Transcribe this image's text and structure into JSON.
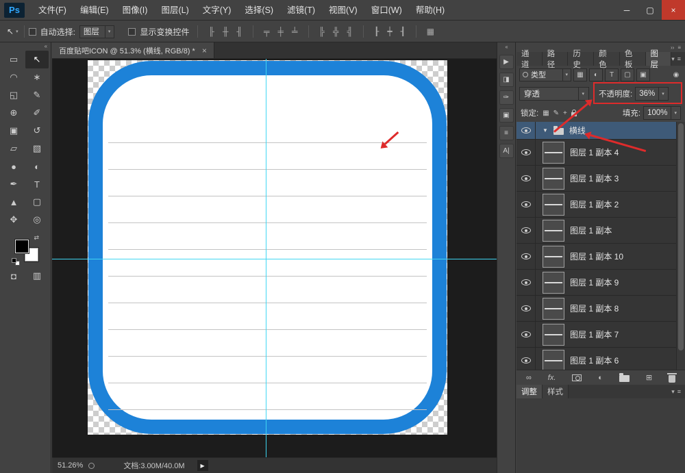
{
  "window": {
    "logo": "Ps",
    "minimize_glyph": "─",
    "maximize_glyph": "▢",
    "close_glyph": "×"
  },
  "menu": {
    "items": [
      "文件(F)",
      "编辑(E)",
      "图像(I)",
      "图层(L)",
      "文字(Y)",
      "选择(S)",
      "滤镜(T)",
      "视图(V)",
      "窗口(W)",
      "帮助(H)"
    ]
  },
  "options": {
    "tool_glyph": "↖",
    "auto_select_label": "自动选择:",
    "auto_select_value": "图层",
    "show_transform_label": "显示变换控件",
    "align_icons": [
      "╟",
      "╫",
      "╢",
      "╤",
      "╪",
      "╧",
      "╠",
      "╬",
      "╣",
      "┠",
      "┿",
      "┨"
    ],
    "distribute_icon": "▦"
  },
  "document": {
    "tab_title": "百度贴吧ICON @ 51.3% (横线, RGB/8) *",
    "close_glyph": "×"
  },
  "toolbar": {
    "collapse_glyph": "‹‹",
    "tools": [
      {
        "name": "rectangular-marquee-tool",
        "glyph": "▭"
      },
      {
        "name": "move-tool",
        "glyph": "↖",
        "selected": true
      },
      {
        "name": "lasso-tool",
        "glyph": "◠"
      },
      {
        "name": "magic-wand-tool",
        "glyph": "∗"
      },
      {
        "name": "crop-tool",
        "glyph": "◱"
      },
      {
        "name": "eyedropper-tool",
        "glyph": "✎"
      },
      {
        "name": "healing-brush-tool",
        "glyph": "⊕"
      },
      {
        "name": "brush-tool",
        "glyph": "✐"
      },
      {
        "name": "clone-stamp-tool",
        "glyph": "▣"
      },
      {
        "name": "history-brush-tool",
        "glyph": "↺"
      },
      {
        "name": "eraser-tool",
        "glyph": "▱"
      },
      {
        "name": "gradient-tool",
        "glyph": "▧"
      },
      {
        "name": "blur-tool",
        "glyph": "●"
      },
      {
        "name": "dodge-tool",
        "glyph": "◐"
      },
      {
        "name": "pen-tool",
        "glyph": "✒"
      },
      {
        "name": "type-tool",
        "glyph": "T"
      },
      {
        "name": "path-selection-tool",
        "glyph": "▲"
      },
      {
        "name": "rectangle-tool",
        "glyph": "▢"
      },
      {
        "name": "hand-tool",
        "glyph": "✥"
      },
      {
        "name": "zoom-tool",
        "glyph": "◎"
      },
      {
        "name": "quick-mask-tool",
        "glyph": "◘"
      },
      {
        "name": "screen-mode-tool",
        "glyph": "▥"
      }
    ]
  },
  "vstrip": {
    "collapse_glyph": "‹‹",
    "icons": [
      {
        "name": "actions-panel-icon",
        "glyph": "▶"
      },
      {
        "name": "styles-panel-icon",
        "glyph": "◨"
      },
      {
        "name": "brush-panel-icon",
        "glyph": "✑"
      },
      {
        "name": "clone-source-panel-icon",
        "glyph": "▣"
      },
      {
        "name": "info-panel-icon",
        "glyph": "≡"
      },
      {
        "name": "character-panel-icon",
        "glyph": "A|"
      }
    ]
  },
  "layers_panel": {
    "collapse_glyph": "››",
    "panel_menu_glyph": "≡",
    "tabs": [
      "通道",
      "路径",
      "历史",
      "颜色",
      "色板",
      "图层"
    ],
    "active_tab": "图层",
    "filter_label": "类型",
    "filter_icons": [
      "▦",
      "◐",
      "T",
      "▢",
      "▣"
    ],
    "filter_pin_glyph": "◉",
    "blend_mode": "穿透",
    "opacity_label": "不透明度:",
    "opacity_value": "36%",
    "lock_label": "锁定:",
    "lock_icons": [
      "▦",
      "✎",
      "+"
    ],
    "fill_label": "填充:",
    "fill_value": "100%",
    "layers": [
      {
        "name": "横线",
        "type": "group",
        "selected": true
      },
      {
        "name": "图层 1 副本 4",
        "type": "layer"
      },
      {
        "name": "图层 1 副本 3",
        "type": "layer"
      },
      {
        "name": "图层 1 副本 2",
        "type": "layer"
      },
      {
        "name": "图层 1 副本",
        "type": "layer"
      },
      {
        "name": "图层 1 副本 10",
        "type": "layer"
      },
      {
        "name": "图层 1 副本 9",
        "type": "layer"
      },
      {
        "name": "图层 1 副本 8",
        "type": "layer"
      },
      {
        "name": "图层 1 副本 7",
        "type": "layer"
      },
      {
        "name": "图层 1 副本 6",
        "type": "layer"
      }
    ],
    "footer": {
      "link_glyph": "∞",
      "fx_label": "fx.",
      "new_layer_glyph": "⊞"
    }
  },
  "bottom_panel": {
    "tabs": [
      "调整",
      "样式"
    ],
    "menu_glyph": "≡"
  },
  "status_bar": {
    "zoom": "51.26%",
    "doc_info": "文档:3.00M/40.0M",
    "expand_glyph": "▶"
  },
  "glyphs": {
    "dropdown": "▾",
    "disclosure": "▼"
  },
  "colors": {
    "accent_blue": "#1d82d8",
    "guide_cyan": "#3fd6f2",
    "annotation_red": "#de2b2b",
    "selected_layer_bg": "#3e5a78"
  }
}
